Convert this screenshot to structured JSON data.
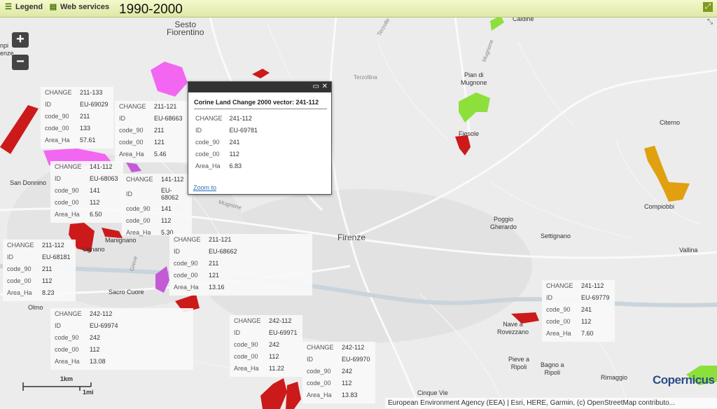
{
  "toolbar": {
    "legend_label": "Legend",
    "web_services_label": "Web services",
    "period": "1990-2000"
  },
  "zoom": {
    "in_label": "+",
    "out_label": "−"
  },
  "popup": {
    "title": "Corine Land Change 2000 vector: 241-112",
    "rows": [
      {
        "k": "CHANGE",
        "v": "241-112"
      },
      {
        "k": "ID",
        "v": "EU-69781"
      },
      {
        "k": "code_90",
        "v": "241"
      },
      {
        "k": "code_00",
        "v": "112"
      },
      {
        "k": "Area_Ha",
        "v": "6.83"
      }
    ],
    "zoom_link": "Zoom to"
  },
  "info_boxes": [
    {
      "rows": [
        {
          "k": "CHANGE",
          "v": "211-133"
        },
        {
          "k": "ID",
          "v": "EU-69029"
        },
        {
          "k": "code_90",
          "v": "211"
        },
        {
          "k": "code_00",
          "v": "133"
        },
        {
          "k": "Area_Ha",
          "v": "57.61"
        }
      ]
    },
    {
      "rows": [
        {
          "k": "CHANGE",
          "v": "211-121"
        },
        {
          "k": "ID",
          "v": "EU-68663"
        },
        {
          "k": "code_90",
          "v": "211"
        },
        {
          "k": "code_00",
          "v": "121"
        },
        {
          "k": "Area_Ha",
          "v": "5.46"
        }
      ]
    },
    {
      "rows": [
        {
          "k": "CHANGE",
          "v": "141-112"
        },
        {
          "k": "ID",
          "v": "EU-68063"
        },
        {
          "k": "code_90",
          "v": "141"
        },
        {
          "k": "code_00",
          "v": "112"
        },
        {
          "k": "Area_Ha",
          "v": "6.50"
        }
      ]
    },
    {
      "rows": [
        {
          "k": "CHANGE",
          "v": "141-112"
        },
        {
          "k": "ID",
          "v": "EU-68062"
        },
        {
          "k": "code_90",
          "v": "141"
        },
        {
          "k": "code_00",
          "v": "112"
        },
        {
          "k": "Area_Ha",
          "v": "5.30"
        }
      ]
    },
    {
      "rows": [
        {
          "k": "CHANGE",
          "v": "211-112"
        },
        {
          "k": "ID",
          "v": "EU-68181"
        },
        {
          "k": "code_90",
          "v": "211"
        },
        {
          "k": "code_00",
          "v": "112"
        },
        {
          "k": "Area_Ha",
          "v": "8.23"
        }
      ]
    },
    {
      "rows": [
        {
          "k": "CHANGE",
          "v": "211-121"
        },
        {
          "k": "ID",
          "v": "EU-68662"
        },
        {
          "k": "code_90",
          "v": "211"
        },
        {
          "k": "code_00",
          "v": "121"
        },
        {
          "k": "Area_Ha",
          "v": "13.16"
        }
      ]
    },
    {
      "rows": [
        {
          "k": "CHANGE",
          "v": "242-112"
        },
        {
          "k": "ID",
          "v": "EU-69974"
        },
        {
          "k": "code_90",
          "v": "242"
        },
        {
          "k": "code_00",
          "v": "112"
        },
        {
          "k": "Area_Ha",
          "v": "13.08"
        }
      ]
    },
    {
      "rows": [
        {
          "k": "CHANGE",
          "v": "242-112"
        },
        {
          "k": "ID",
          "v": "EU-69971"
        },
        {
          "k": "code_90",
          "v": "242"
        },
        {
          "k": "code_00",
          "v": "112"
        },
        {
          "k": "Area_Ha",
          "v": "11.22"
        }
      ]
    },
    {
      "rows": [
        {
          "k": "CHANGE",
          "v": "242-112"
        },
        {
          "k": "ID",
          "v": "EU-69970"
        },
        {
          "k": "code_90",
          "v": "242"
        },
        {
          "k": "code_00",
          "v": "112"
        },
        {
          "k": "Area_Ha",
          "v": "13.83"
        }
      ]
    },
    {
      "rows": [
        {
          "k": "CHANGE",
          "v": "241-112"
        },
        {
          "k": "ID",
          "v": "EU-69779"
        },
        {
          "k": "code_90",
          "v": "241"
        },
        {
          "k": "code_00",
          "v": "112"
        },
        {
          "k": "Area_Ha",
          "v": "7.60"
        }
      ]
    }
  ],
  "places": {
    "sesto": "Sesto\nFiorentino",
    "caldine": "Caldine",
    "pian": "Pian di\nMugnone",
    "fiesole": "Fiesole",
    "citerno": "Citerno",
    "compiobbi": "Compiobbi",
    "san_donnino": "San Donnino",
    "manignano": "Manignano",
    "ugnano": "Ugnano",
    "sacro_cuore": "Sacro Cuore",
    "olmo": "Olmo",
    "firenze": "Firenze",
    "poggio": "Poggio\nGherardo",
    "settignano": "Settignano",
    "vallina": "Vallina",
    "nave": "Nave a\nRovezzano",
    "pieve": "Pieve a\nRipoli",
    "bagno": "Bagno a\nRipoli",
    "rimaggio": "Rimaggio",
    "cinque_vie": "Cinque Vie",
    "edge_left": "npi\nenze",
    "road_terzolle": "Terzolle",
    "road_terzollina": "Terzollina",
    "road_mugnone1": "Mugnone",
    "road_mugnone2": "Mugnone",
    "road_greve": "Greve"
  },
  "scale": {
    "km": "1km",
    "mi": "1mi"
  },
  "attribution": "European Environment Agency (EEA) | Esri, HERE, Garmin, (c) OpenStreetMap contributo...",
  "logo": "Copernicus",
  "colors": {
    "red": "#cc1a1a",
    "magenta": "#f266f2",
    "purple": "#c45ad6",
    "green": "#8de03c",
    "orange": "#e0a010",
    "river": "#c9d4dc"
  }
}
